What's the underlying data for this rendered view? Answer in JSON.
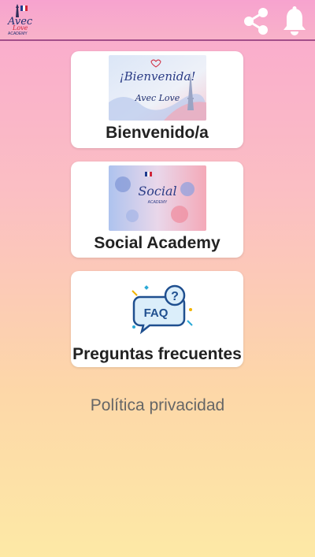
{
  "header": {
    "logo_text": "Avec Love",
    "logo_sub": "ACADEMY",
    "icons": [
      "share-icon",
      "bell-icon"
    ]
  },
  "cards": [
    {
      "title": "Bienvenido/a",
      "image_text": "¡Bienvenida!",
      "image_logo": "Avec Love"
    },
    {
      "title": "Social Academy",
      "image_text": "Social",
      "image_sub": "ACADEMY"
    },
    {
      "title": "Preguntas frecuentes",
      "image_text": "FAQ"
    }
  ],
  "privacy_link": "Política privacidad",
  "colors": {
    "header_border": "#a44e8a",
    "icon_white": "#ffffff",
    "title_text": "#222222",
    "link_text": "#666666"
  }
}
